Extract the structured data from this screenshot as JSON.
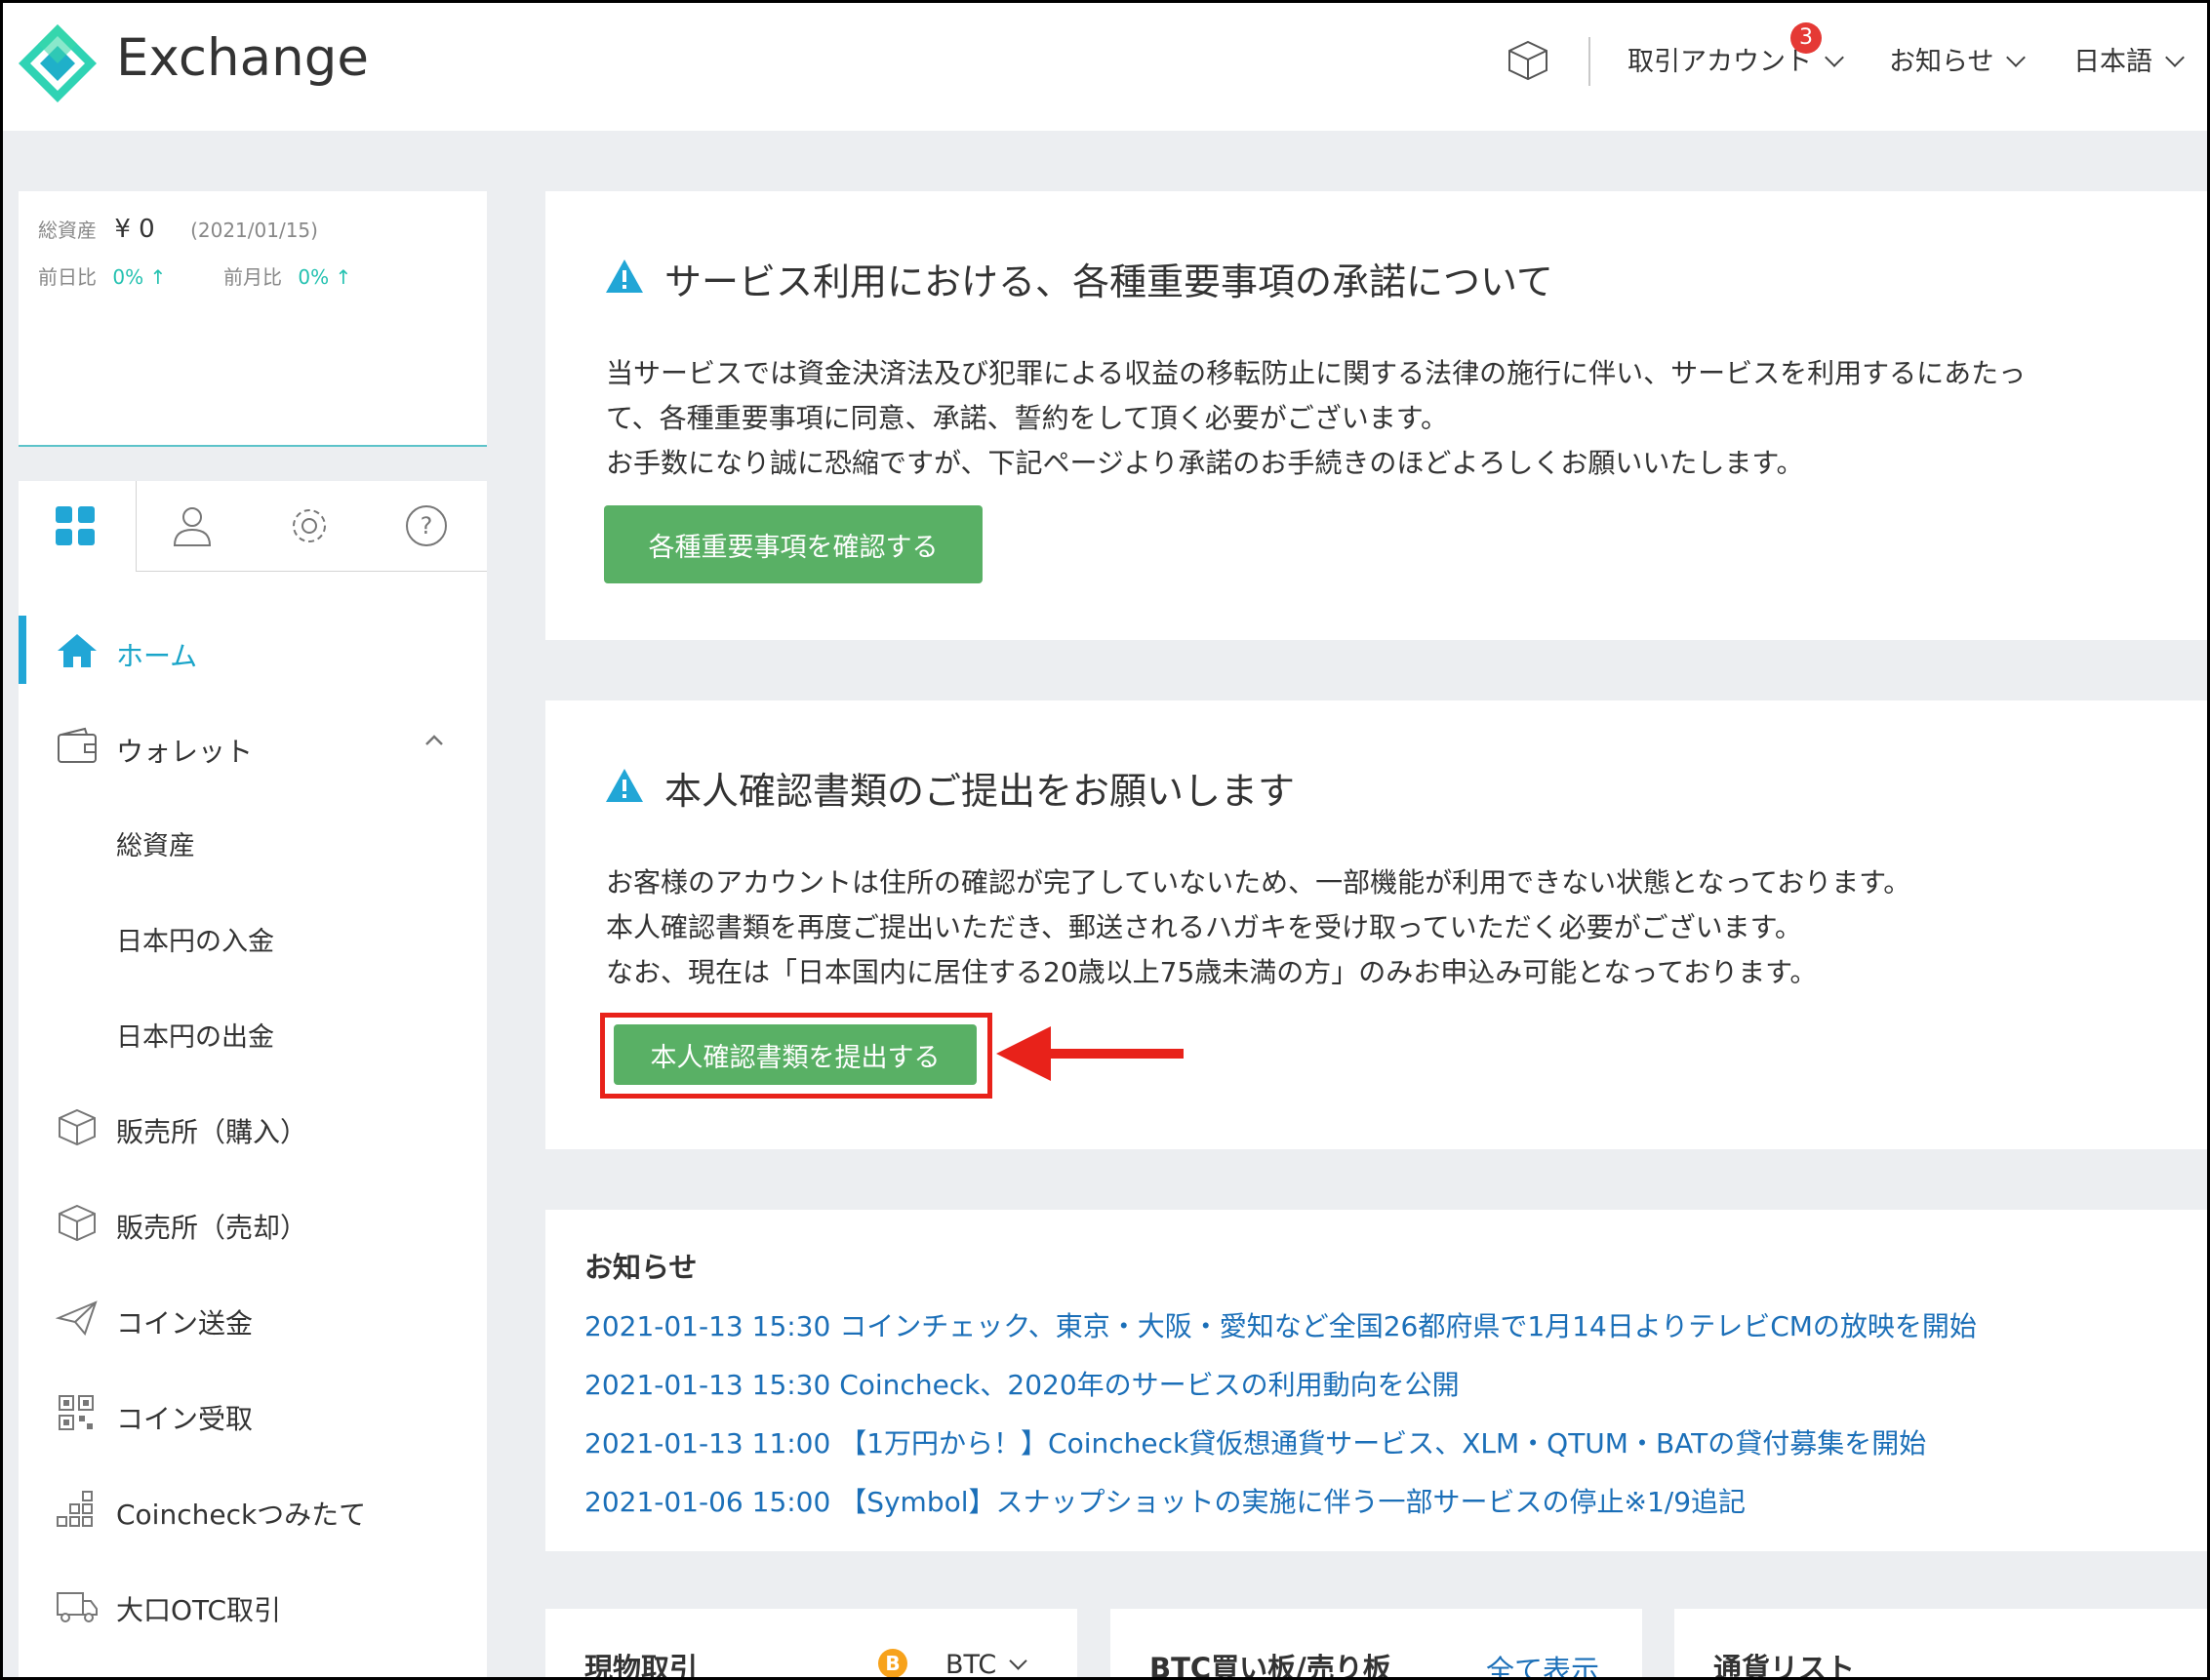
{
  "header": {
    "brand": "Exchange",
    "nav": {
      "trading_account": "取引アカウント",
      "trading_badge": "3",
      "notices": "お知らせ",
      "language": "日本語"
    }
  },
  "assets": {
    "total_label": "総資産",
    "total_value": "¥ 0",
    "date": "(2021/01/15)",
    "day_label": "前日比",
    "day_value": "0% ↑",
    "month_label": "前月比",
    "month_value": "0% ↑"
  },
  "sidebar": {
    "tabs": [
      "dashboard",
      "account",
      "settings",
      "help"
    ],
    "items": {
      "home": "ホーム",
      "wallet": "ウォレット",
      "wallet_sub": [
        "総資産",
        "日本円の入金",
        "日本円の出金"
      ],
      "buy": "販売所（購入）",
      "sell": "販売所（売却）",
      "send": "コイン送金",
      "receive": "コイン受取",
      "tsumitate": "Coincheckつみたて",
      "otc": "大口OTC取引"
    }
  },
  "card1": {
    "title": "サービス利用における、各種重要事項の承諾について",
    "lines": [
      "当サービスでは資金決済法及び犯罪による収益の移転防止に関する法律の施行に伴い、サービスを利用するにあたっ",
      "て、各種重要事項に同意、承諾、誓約をして頂く必要がございます。",
      "お手数になり誠に恐縮ですが、下記ページより承諾のお手続きのほどよろしくお願いいたします。"
    ],
    "button": "各種重要事項を確認する"
  },
  "card2": {
    "title": "本人確認書類のご提出をお願いします",
    "lines": [
      "お客様のアカウントは住所の確認が完了していないため、一部機能が利用できない状態となっております。",
      "本人確認書類を再度ご提出いただき、郵送されるハガキを受け取っていただく必要がございます。",
      "なお、現在は「日本国内に居住する20歳以上75歳未満の方」のみお申込み可能となっております。"
    ],
    "button": "本人確認書類を提出する"
  },
  "news": {
    "title": "お知らせ",
    "items": [
      "2021-01-13 15:30 コインチェック、東京・大阪・愛知など全国26都府県で1月14日よりテレビCMの放映を開始",
      "2021-01-13 15:30 Coincheck、2020年のサービスの利用動向を公開",
      "2021-01-13 11:00 【1万円から！】Coincheck貸仮想通貨サービス、XLM・QTUM・BATの貸付募集を開始",
      "2021-01-06 15:00 【Symbol】スナップショットの実施に伴う一部サービスの停止※1/9追記"
    ]
  },
  "bottom": {
    "spot_title": "現物取引",
    "spot_coin": "BTC",
    "orderbook_title": "BTC買い板/売り板",
    "orderbook_link": "全て表示",
    "currency_title": "通貨リスト"
  },
  "colors": {
    "accent": "#21a6d6",
    "button_green": "#59b065",
    "highlight_red": "#e8221a",
    "link_blue": "#1b6fb8",
    "positive": "#23c1b0"
  }
}
